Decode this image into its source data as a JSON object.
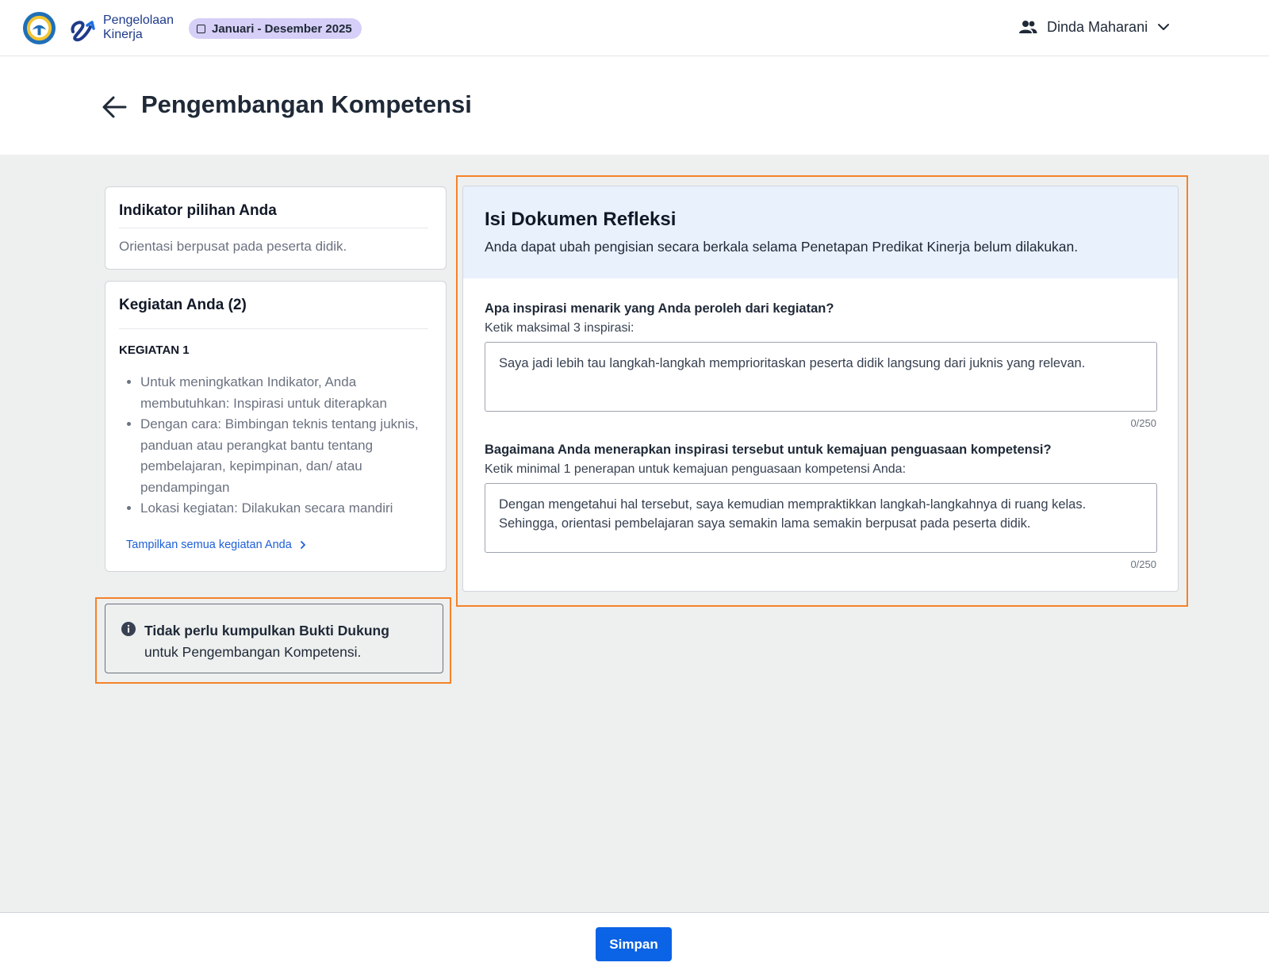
{
  "header": {
    "brand_line1": "Pengelolaan",
    "brand_line2": "Kinerja",
    "period": "Januari - Desember 2025",
    "user_name": "Dinda Maharani"
  },
  "page": {
    "title": "Pengembangan Kompetensi"
  },
  "indicator": {
    "heading": "Indikator pilihan Anda",
    "value": "Orientasi berpusat pada peserta didik."
  },
  "activities": {
    "heading": "Kegiatan Anda (2)",
    "activity_title": "KEGIATAN 1",
    "items": [
      "Untuk meningkatkan Indikator, Anda membutuhkan: Inspirasi untuk diterapkan",
      "Dengan cara: Bimbingan teknis tentang juknis, panduan atau perangkat bantu tentang pembelajaran, kepimpinan, dan/ atau pendampingan",
      "Lokasi kegiatan: Dilakukan secara mandiri"
    ],
    "show_all_label": "Tampilkan semua kegiatan Anda"
  },
  "notice": {
    "strong": "Tidak perlu kumpulkan Bukti Dukung",
    "text": "untuk Pengembangan Kompetensi."
  },
  "document": {
    "title": "Isi Dokumen Refleksi",
    "subtitle": "Anda dapat ubah pengisian secara berkala selama Penetapan Predikat Kinerja belum dilakukan.",
    "questions": [
      {
        "question": "Apa inspirasi menarik yang Anda peroleh dari kegiatan?",
        "hint": "Ketik maksimal 3 inspirasi:",
        "answer": "Saya jadi lebih tau langkah-langkah memprioritaskan peserta didik langsung dari juknis yang relevan.",
        "counter": "0/250"
      },
      {
        "question": "Bagaimana Anda menerapkan inspirasi tersebut untuk kemajuan penguasaan kompetensi?",
        "hint": "Ketik minimal 1 penerapan untuk kemajuan penguasaan kompetensi Anda:",
        "answer": "Dengan mengetahui hal tersebut, saya kemudian mempraktikkan langkah-langkahnya di ruang kelas. Sehingga, orientasi pembelajaran saya semakin lama semakin berpusat pada peserta didik.",
        "counter": "0/250"
      }
    ]
  },
  "footer": {
    "save_label": "Simpan"
  },
  "colors": {
    "primary": "#0b63e5",
    "highlight": "#f5822a",
    "chip": "#d6cff7",
    "doc_header": "#e8f1fc",
    "link": "#1d5fd6"
  }
}
